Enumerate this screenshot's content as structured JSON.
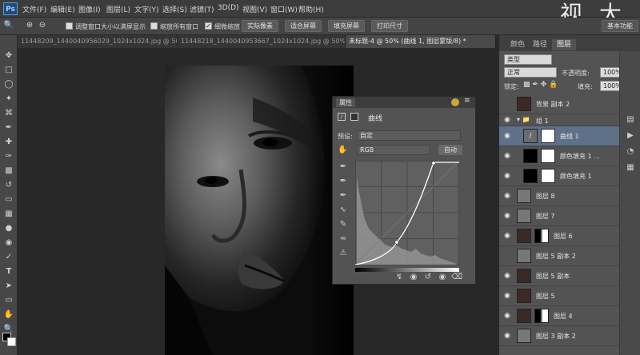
{
  "app": {
    "logo": "Ps",
    "menus": [
      "文件(F)",
      "编辑(E)",
      "图像(I)",
      "图层(L)",
      "文字(Y)",
      "选择(S)",
      "滤镜(T)",
      "3D(D)",
      "视图(V)",
      "窗口(W)",
      "帮助(H)"
    ],
    "watermark": "视 大 图",
    "window_controls": [
      "—",
      "▢",
      "✕"
    ]
  },
  "options_bar": {
    "checkbox1_label": "调整窗口大小以满屏显示",
    "checkbox2_label": "缩放所有窗口",
    "checkbox3_label": "细微缩放",
    "btn_actual": "实际像素",
    "btn_fit": "适合屏幕",
    "btn_fill": "填充屏幕",
    "btn_print": "打印尺寸",
    "workspace": "基本功能"
  },
  "doc_tabs": [
    {
      "label": "11448209_1440040956029_1024x1024.jpg @ 50.8...",
      "active": false
    },
    {
      "label": "11448218_1440040953667_1024x1024.jpg @ 50% ...",
      "active": false
    },
    {
      "label": "未标题-4 @ 50% (曲线 1, 图层蒙版/8) *",
      "active": true
    }
  ],
  "tools": [
    "move",
    "marquee",
    "lasso",
    "quick-select",
    "crop",
    "eyedropper",
    "healing",
    "brush",
    "stamp",
    "history-brush",
    "eraser",
    "gradient",
    "blur",
    "dodge",
    "pen",
    "type",
    "path-select",
    "shape",
    "hand",
    "zoom"
  ],
  "properties": {
    "tab": "属性",
    "adjustment_title": "曲线",
    "preset_label": "预设:",
    "preset_value": "自定",
    "channel_value": "RGB",
    "auto_button": "自动"
  },
  "right_panel": {
    "tabs": [
      "颜色",
      "路径",
      "图层"
    ],
    "active_tab": "图层",
    "filter_kind": "类型",
    "blend_mode": "正常",
    "opacity_label": "不透明度:",
    "opacity_value": "100%",
    "lock_label": "锁定:",
    "fill_label": "填充:",
    "fill_value": "100%",
    "layers": [
      {
        "name": "背景 副本 2",
        "visible": false,
        "kind": "face",
        "selected": false
      },
      {
        "name": "组 1",
        "visible": true,
        "kind": "group",
        "selected": false
      },
      {
        "name": "曲线 1",
        "visible": true,
        "kind": "curves",
        "selected": true
      },
      {
        "name": "颜色填充 1 ...",
        "visible": true,
        "kind": "fill",
        "selected": false
      },
      {
        "name": "颜色填充 1",
        "visible": true,
        "kind": "fill",
        "selected": false
      },
      {
        "name": "图层 8",
        "visible": true,
        "kind": "gray",
        "selected": false
      },
      {
        "name": "图层 7",
        "visible": true,
        "kind": "gray",
        "selected": false
      },
      {
        "name": "图层 6",
        "visible": true,
        "kind": "face-mask",
        "selected": false
      },
      {
        "name": "图层 5 副本 2",
        "visible": false,
        "kind": "gray",
        "selected": false
      },
      {
        "name": "图层 5 副本",
        "visible": true,
        "kind": "face",
        "selected": false
      },
      {
        "name": "图层 5",
        "visible": true,
        "kind": "face",
        "selected": false
      },
      {
        "name": "图层 4",
        "visible": true,
        "kind": "face-mask",
        "selected": false
      },
      {
        "name": "图层 3 副本 2",
        "visible": true,
        "kind": "gray",
        "selected": false
      }
    ]
  },
  "colors": {
    "ui_bg": "#535353",
    "menubar": "#3c3c3c",
    "selected_layer": "#5f7089",
    "accent_dot": "#c8a83a"
  }
}
